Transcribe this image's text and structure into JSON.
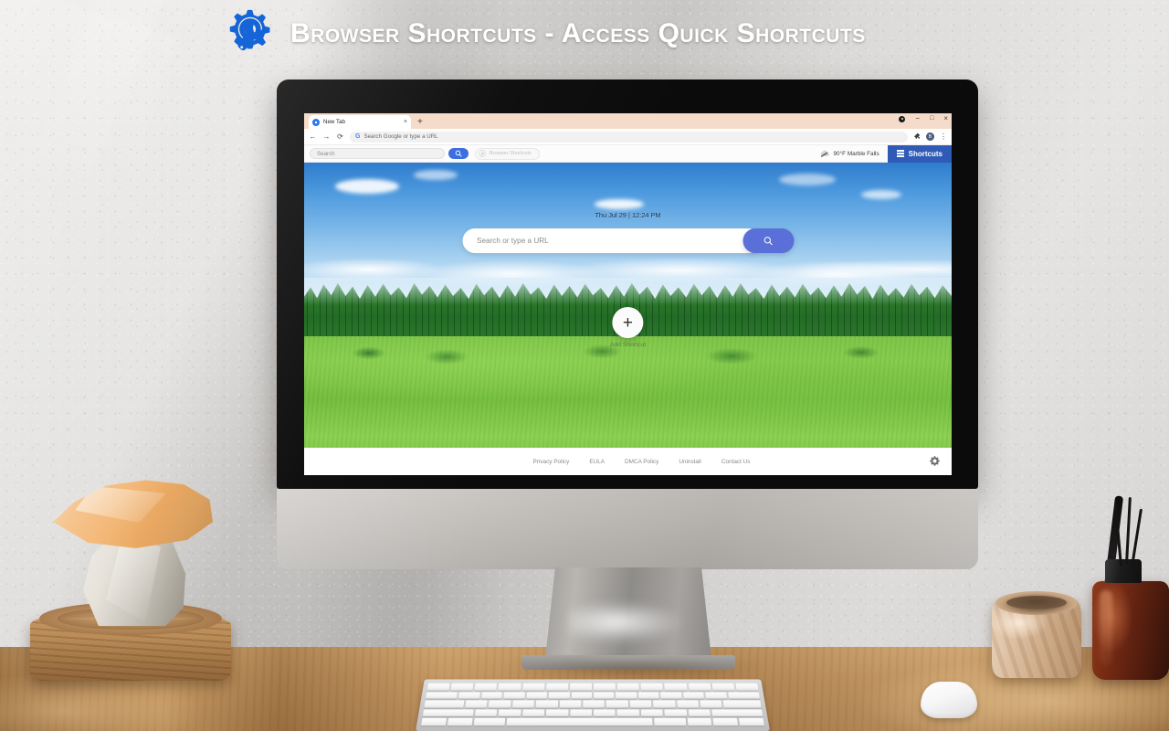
{
  "banner": {
    "title": "Browser Shortcuts - Access Quick Shortcuts",
    "logo_icon": "gear-wrench-icon",
    "accent_color": "#1a73e8",
    "title_color": "#ffffff"
  },
  "browser": {
    "tab": {
      "title": "New Tab",
      "favicon_icon": "extension-logo-icon",
      "close_icon": "×",
      "new_tab_icon": "+"
    },
    "window_controls": {
      "record_dot": "record-dot-icon",
      "minimize": "−",
      "maximize": "□",
      "close": "×"
    },
    "omnibox": {
      "back_icon": "←",
      "forward_icon": "→",
      "reload_icon": "⟳",
      "search_engine_icon": "G",
      "placeholder": "Search Google or type a URL",
      "value": "",
      "extensions_icon": "puzzle-piece-icon",
      "profile_initial": "B",
      "menu_icon": "⋮"
    },
    "extension_toolbar": {
      "search_placeholder": "Search",
      "search_value": "",
      "search_button_icon": "magnifier-icon",
      "brand_pill_label": "Browser Shortcuts",
      "brand_pill_icon": "gear-wrench-icon",
      "weather": {
        "icon": "cloud-icon",
        "text": "90°F Marble Falls",
        "temperature": "90°F",
        "location": "Marble Falls"
      },
      "shortcuts_button": {
        "label": "Shortcuts",
        "icon": "hamburger-icon",
        "color": "#2f5bb7"
      }
    },
    "newtab": {
      "datetime": "Thu Jul 29 | 12:24 PM",
      "search": {
        "placeholder": "Search or type a URL",
        "value": "",
        "button_icon": "magnifier-icon",
        "button_color": "#5a6fd8"
      },
      "add_shortcut": {
        "label": "Add Shortcut",
        "icon": "plus-icon"
      },
      "footer": {
        "links": [
          {
            "label": "Privacy Policy"
          },
          {
            "label": "EULA"
          },
          {
            "label": "DMCA Policy"
          },
          {
            "label": "Uninstall"
          },
          {
            "label": "Contact Us"
          }
        ],
        "settings_icon": "gear-icon"
      }
    }
  },
  "scene": {
    "monitor": "imac-style-monitor",
    "desk_objects": [
      {
        "name": "stacked-rocks",
        "description": "orange calcite on white stone atop wood log slice"
      },
      {
        "name": "keyboard",
        "description": "white wireless keyboard"
      },
      {
        "name": "mouse",
        "description": "white wireless mouse"
      },
      {
        "name": "marble-bowl",
        "description": "onyx stone bowl"
      },
      {
        "name": "reed-diffuser",
        "description": "amber glass bottle with black reed sticks"
      }
    ]
  }
}
